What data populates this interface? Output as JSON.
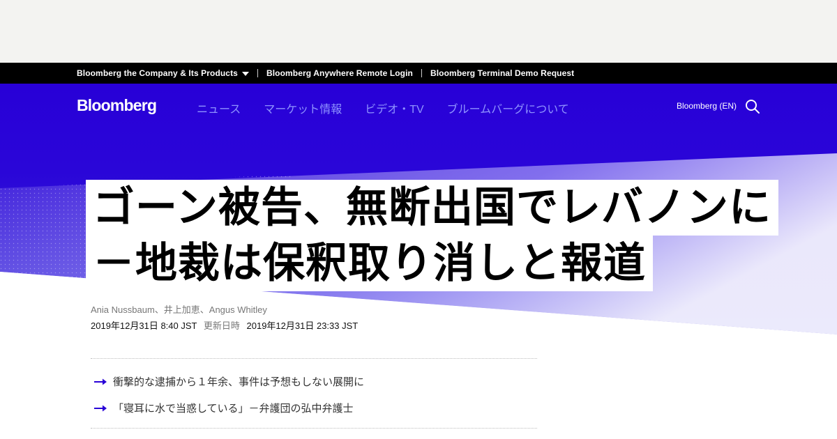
{
  "colors": {
    "ad_background": "#f3f3f1",
    "top_bar": "#000000",
    "brand_blue": "#2800d7",
    "nav_link": "#8f93ff",
    "headline_bg": "#ffffff"
  },
  "top_bar": {
    "items": [
      {
        "label": "Bloomberg the Company & Its Products",
        "has_dropdown": true
      },
      {
        "label": "Bloomberg Anywhere Remote Login"
      },
      {
        "label": "Bloomberg Terminal Demo Request"
      }
    ]
  },
  "nav": {
    "logo": "Bloomberg",
    "links": [
      "ニュース",
      "マーケット情報",
      "ビデオ・TV",
      "ブルームバーグについて"
    ],
    "edition": "Bloomberg (EN)",
    "search_icon": "search-icon"
  },
  "article": {
    "headline_line1": "ゴーン被告、無断出国でレバノンに",
    "headline_line2": "－地裁は保釈取り消しと報道",
    "authors": "Ania Nussbaum、井上加恵、Angus Whitley",
    "published": "2019年12月31日 8:40 JST",
    "updated_label": "更新日時",
    "updated": "2019年12月31日 23:33 JST"
  },
  "related": [
    {
      "title": "衝撃的な逮捕から１年余、事件は予想もしない展開に",
      "icon": "arrow-right-icon"
    },
    {
      "title": "「寝耳に水で当惑している」－弁護団の弘中弁護士",
      "icon": "arrow-right-icon"
    }
  ]
}
